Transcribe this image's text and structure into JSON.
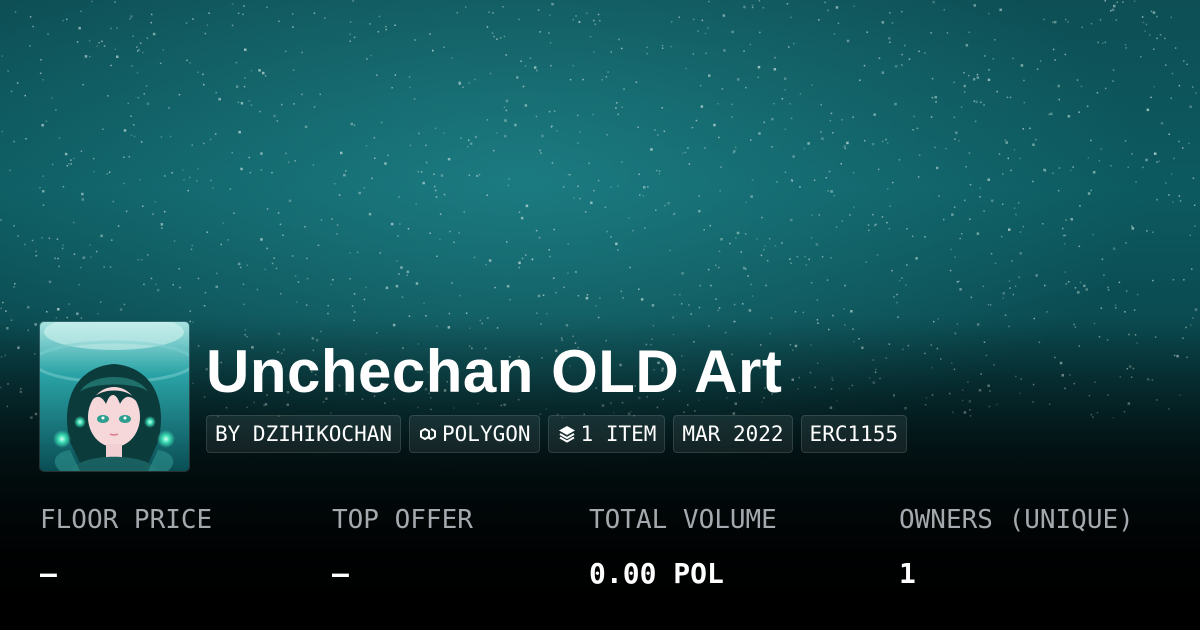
{
  "collection": {
    "title": "Unchechan OLD Art",
    "avatar_icon": "anime-girl-portrait-avatar",
    "pills": [
      {
        "label": "BY DZIHIKOCHAN",
        "icon": null
      },
      {
        "label": "POLYGON",
        "icon": "polygon-chain-icon"
      },
      {
        "label": "1 ITEM",
        "icon": "layers-stack-icon"
      },
      {
        "label": "MAR 2022",
        "icon": null
      },
      {
        "label": "ERC1155",
        "icon": null
      }
    ]
  },
  "stats": [
    {
      "label": "FLOOR PRICE",
      "value": "–"
    },
    {
      "label": "TOP OFFER",
      "value": "–"
    },
    {
      "label": "TOTAL VOLUME",
      "value": "0.00 POL"
    },
    {
      "label": "OWNERS (UNIQUE)",
      "value": "1"
    }
  ],
  "colors": {
    "banner_teal": "#0c5a60",
    "background_dark": "#000000",
    "text_primary": "#ffffff",
    "text_muted": "#a4a9ad"
  }
}
